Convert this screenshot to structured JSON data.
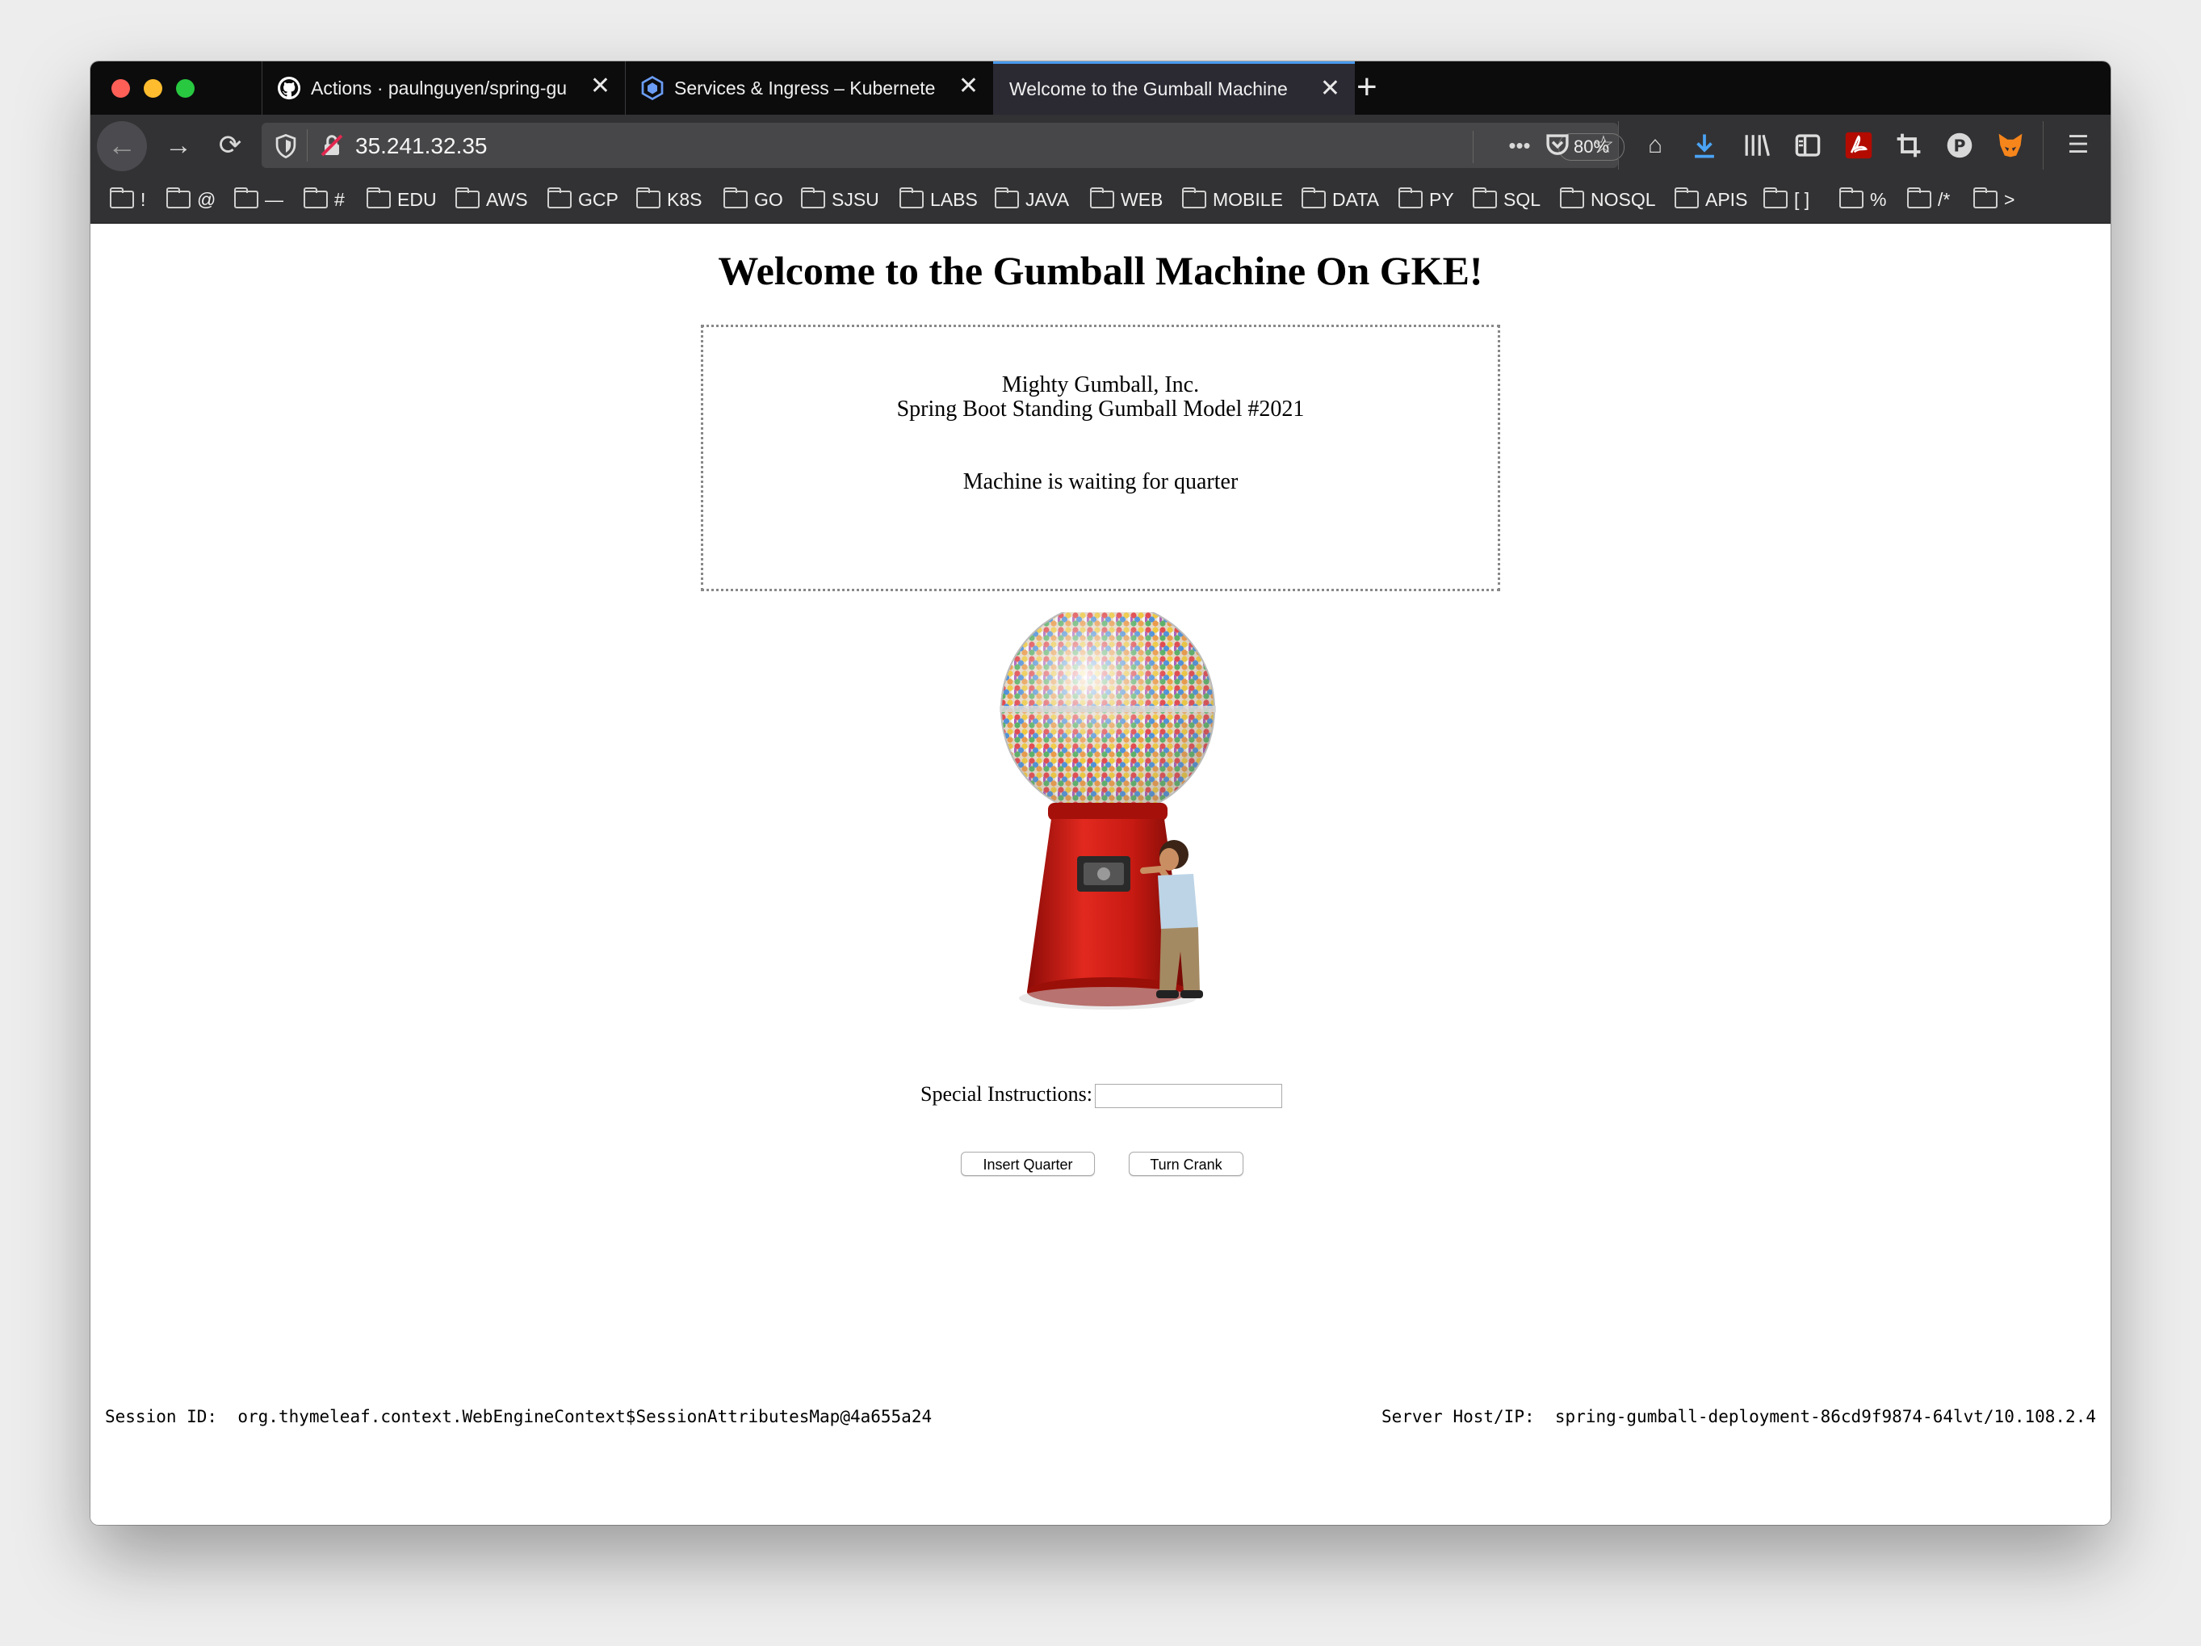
{
  "browser": {
    "tabs": [
      {
        "label": "Actions · paulnguyen/spring-gu",
        "active": false
      },
      {
        "label": "Services & Ingress – Kubernete",
        "active": false
      },
      {
        "label": "Welcome to the Gumball Machine",
        "active": true
      }
    ],
    "new_tab_label": "+",
    "url": "35.241.32.35",
    "zoom": "80%",
    "bookmarks": [
      "!",
      "@",
      "—",
      "#",
      "EDU",
      "AWS",
      "GCP",
      "K8S",
      "GO",
      "SJSU",
      "LABS",
      "JAVA",
      "WEB",
      "MOBILE",
      "DATA",
      "PY",
      "SQL",
      "NOSQL",
      "APIS",
      "[ ]",
      "%",
      "/*",
      ">"
    ]
  },
  "page": {
    "title": "Welcome to the Gumball Machine On GKE!",
    "company": "Mighty Gumball, Inc.",
    "model": "Spring Boot Standing Gumball Model #2021",
    "status": "Machine is waiting for quarter",
    "instructions_label": "Special Instructions:",
    "instructions_value": "",
    "insert_quarter_label": "Insert Quarter",
    "turn_crank_label": "Turn Crank",
    "session_label": "Session ID:",
    "session_value": "org.thymeleaf.context.WebEngineContext$SessionAttributesMap@4a655a24",
    "server_label": "Server Host/IP:",
    "server_value": "spring-gumball-deployment-86cd9f9874-64lvt/10.108.2.4"
  }
}
